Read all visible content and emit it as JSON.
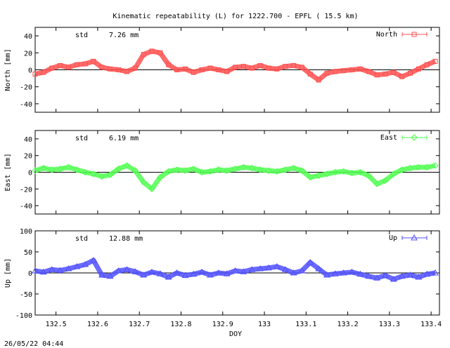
{
  "title": "Kinematic repeatability (L) for 1222.700 - EPFL  ( 15.5 km)",
  "xlabel": "DOY",
  "timestamp": "26/05/22 04:44",
  "chart_data": [
    {
      "type": "line",
      "name": "North",
      "ylabel": "North [mm]",
      "std_label": "std",
      "std_value": "7.26 mm",
      "color": "#ff5050",
      "marker": "square-open",
      "xlim": [
        132.45,
        133.42
      ],
      "ylim": [
        -50,
        50
      ],
      "yticks": [
        -40,
        -20,
        0,
        20,
        40
      ],
      "xticks": [
        132.5,
        132.6,
        132.7,
        132.8,
        132.9,
        133,
        133.1,
        133.2,
        133.3,
        133.4
      ],
      "x": [
        132.45,
        132.47,
        132.49,
        132.51,
        132.53,
        132.55,
        132.57,
        132.59,
        132.61,
        132.63,
        132.65,
        132.67,
        132.69,
        132.71,
        132.73,
        132.75,
        132.77,
        132.79,
        132.81,
        132.83,
        132.85,
        132.87,
        132.89,
        132.91,
        132.93,
        132.95,
        132.97,
        132.99,
        133.01,
        133.03,
        133.05,
        133.07,
        133.09,
        133.11,
        133.13,
        133.15,
        133.17,
        133.19,
        133.21,
        133.23,
        133.25,
        133.27,
        133.29,
        133.31,
        133.33,
        133.35,
        133.37,
        133.39,
        133.41
      ],
      "values": [
        -5,
        -3,
        2,
        5,
        3,
        6,
        7,
        10,
        3,
        1,
        0,
        -2,
        2,
        18,
        22,
        20,
        6,
        0,
        1,
        -3,
        0,
        2,
        0,
        -2,
        3,
        4,
        2,
        5,
        2,
        1,
        4,
        5,
        3,
        -5,
        -12,
        -4,
        -2,
        -1,
        0,
        1,
        -2,
        -6,
        -5,
        -3,
        -8,
        -4,
        1,
        6,
        10
      ]
    },
    {
      "type": "line",
      "name": "East",
      "ylabel": "East [mm]",
      "std_label": "std",
      "std_value": "6.19 mm",
      "color": "#50ff50",
      "marker": "diamond-open",
      "xlim": [
        132.45,
        133.42
      ],
      "ylim": [
        -50,
        50
      ],
      "yticks": [
        -40,
        -20,
        0,
        20,
        40
      ],
      "xticks": [
        132.5,
        132.6,
        132.7,
        132.8,
        132.9,
        133,
        133.1,
        133.2,
        133.3,
        133.4
      ],
      "x": [
        132.45,
        132.47,
        132.49,
        132.51,
        132.53,
        132.55,
        132.57,
        132.59,
        132.61,
        132.63,
        132.65,
        132.67,
        132.69,
        132.71,
        132.73,
        132.75,
        132.77,
        132.79,
        132.81,
        132.83,
        132.85,
        132.87,
        132.89,
        132.91,
        132.93,
        132.95,
        132.97,
        132.99,
        133.01,
        133.03,
        133.05,
        133.07,
        133.09,
        133.11,
        133.13,
        133.15,
        133.17,
        133.19,
        133.21,
        133.23,
        133.25,
        133.27,
        133.29,
        133.31,
        133.33,
        133.35,
        133.37,
        133.39,
        133.41
      ],
      "values": [
        2,
        5,
        3,
        4,
        6,
        3,
        0,
        -2,
        -5,
        -3,
        4,
        8,
        2,
        -12,
        -20,
        -6,
        1,
        3,
        2,
        4,
        0,
        1,
        3,
        2,
        4,
        6,
        5,
        3,
        2,
        1,
        3,
        5,
        2,
        -6,
        -4,
        -2,
        0,
        1,
        -1,
        0,
        -4,
        -14,
        -10,
        -2,
        3,
        5,
        6,
        6,
        8
      ]
    },
    {
      "type": "line",
      "name": "Up",
      "ylabel": "Up [mm]",
      "std_label": "std",
      "std_value": "12.88 mm",
      "color": "#5050ff",
      "marker": "triangle-open",
      "xlim": [
        132.45,
        133.42
      ],
      "ylim": [
        -100,
        100
      ],
      "yticks": [
        -100,
        -50,
        0,
        50,
        100
      ],
      "xticks": [
        132.5,
        132.6,
        132.7,
        132.8,
        132.9,
        133,
        133.1,
        133.2,
        133.3,
        133.4
      ],
      "x": [
        132.45,
        132.47,
        132.49,
        132.51,
        132.53,
        132.55,
        132.57,
        132.59,
        132.61,
        132.63,
        132.65,
        132.67,
        132.69,
        132.71,
        132.73,
        132.75,
        132.77,
        132.79,
        132.81,
        132.83,
        132.85,
        132.87,
        132.89,
        132.91,
        132.93,
        132.95,
        132.97,
        132.99,
        133.01,
        133.03,
        133.05,
        133.07,
        133.09,
        133.11,
        133.13,
        133.15,
        133.17,
        133.19,
        133.21,
        133.23,
        133.25,
        133.27,
        133.29,
        133.31,
        133.33,
        133.35,
        133.37,
        133.39,
        133.41
      ],
      "values": [
        5,
        2,
        8,
        6,
        10,
        15,
        20,
        30,
        -5,
        -8,
        5,
        8,
        3,
        -5,
        2,
        -2,
        -10,
        0,
        -6,
        -3,
        2,
        -5,
        0,
        -2,
        5,
        3,
        8,
        10,
        12,
        15,
        8,
        0,
        5,
        25,
        10,
        -5,
        -2,
        0,
        2,
        -3,
        -8,
        -12,
        -6,
        -15,
        -8,
        -5,
        -10,
        -3,
        0
      ]
    }
  ]
}
